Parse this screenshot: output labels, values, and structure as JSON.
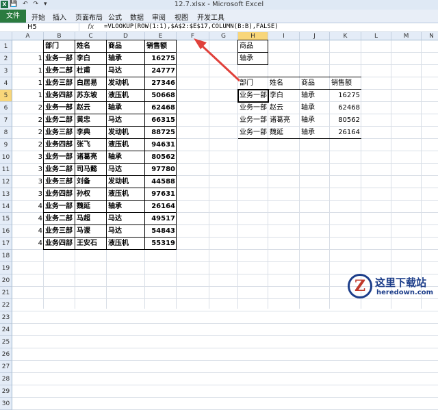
{
  "window": {
    "title": "12.7.xlsx - Microsoft Excel",
    "app_icon": "X",
    "qat": [
      "save-icon",
      "undo-icon",
      "redo-icon",
      "customize-icon"
    ]
  },
  "ribbon": {
    "file_tab": "文件",
    "tabs": [
      "开始",
      "插入",
      "页面布局",
      "公式",
      "数据",
      "审阅",
      "视图",
      "开发工具"
    ]
  },
  "formula_bar": {
    "name_box": "H5",
    "fx": "fx",
    "formula": "=VLOOKUP(ROW(1:1),$A$2:$E$17,COLUMN(B:B),FALSE)"
  },
  "columns": [
    "A",
    "B",
    "C",
    "D",
    "E",
    "F",
    "G",
    "H",
    "I",
    "J",
    "K",
    "L",
    "M",
    "N"
  ],
  "rows": [
    "1",
    "2",
    "3",
    "4",
    "5",
    "6",
    "7",
    "8",
    "9",
    "10",
    "11",
    "12",
    "13",
    "14",
    "15",
    "16",
    "17",
    "18",
    "19",
    "20",
    "21",
    "22",
    "23",
    "24",
    "25",
    "26",
    "27",
    "28",
    "29",
    "30"
  ],
  "selected_cell": {
    "col": "H",
    "row": "5"
  },
  "source_table": {
    "headers": [
      "部门",
      "姓名",
      "商品",
      "销售额"
    ],
    "rows": [
      [
        "1",
        "业务一部",
        "李白",
        "轴承",
        "16275"
      ],
      [
        "1",
        "业务二部",
        "杜甫",
        "马达",
        "24777"
      ],
      [
        "1",
        "业务三部",
        "白居易",
        "发动机",
        "27346"
      ],
      [
        "1",
        "业务四部",
        "苏东坡",
        "液压机",
        "50668"
      ],
      [
        "2",
        "业务一部",
        "赵云",
        "轴承",
        "62468"
      ],
      [
        "2",
        "业务二部",
        "黄忠",
        "马达",
        "66315"
      ],
      [
        "2",
        "业务三部",
        "李典",
        "发动机",
        "88725"
      ],
      [
        "2",
        "业务四部",
        "张飞",
        "液压机",
        "94631"
      ],
      [
        "3",
        "业务一部",
        "诸葛亮",
        "轴承",
        "80562"
      ],
      [
        "3",
        "业务二部",
        "司马懿",
        "马达",
        "97780"
      ],
      [
        "3",
        "业务三部",
        "刘备",
        "发动机",
        "44588"
      ],
      [
        "3",
        "业务四部",
        "孙权",
        "液压机",
        "97631"
      ],
      [
        "4",
        "业务一部",
        "魏延",
        "轴承",
        "26164"
      ],
      [
        "4",
        "业务二部",
        "马超",
        "马达",
        "49517"
      ],
      [
        "4",
        "业务三部",
        "马谡",
        "马达",
        "54843"
      ],
      [
        "4",
        "业务四部",
        "王安石",
        "液压机",
        "55319"
      ]
    ]
  },
  "criteria": {
    "label": "商品",
    "value": "轴承"
  },
  "result_table": {
    "headers": [
      "部门",
      "姓名",
      "商品",
      "销售额"
    ],
    "rows": [
      [
        "业务一部",
        "李白",
        "轴承",
        "16275"
      ],
      [
        "业务一部",
        "赵云",
        "轴承",
        "62468"
      ],
      [
        "业务一部",
        "诸葛亮",
        "轴承",
        "80562"
      ],
      [
        "业务一部",
        "魏延",
        "轴承",
        "26164"
      ]
    ]
  },
  "watermark": {
    "logo": "Z",
    "name": "这里下载站",
    "url": "heredown.com"
  },
  "colors": {
    "selected_header": "#f8d67a",
    "header_bg": "#e4ecf7",
    "file_tab": "#2b7b3f",
    "arrow": "#e0413b"
  }
}
